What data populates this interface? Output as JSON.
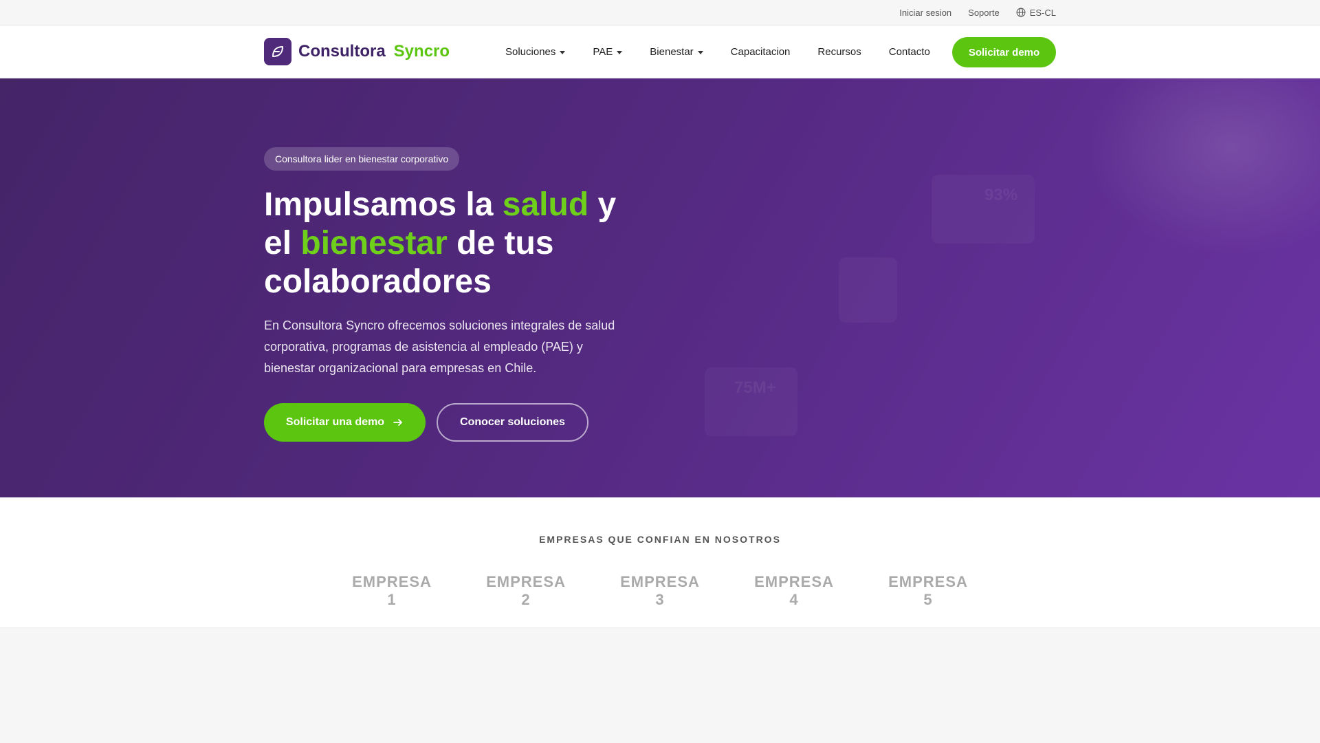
{
  "topbar": {
    "login": "Iniciar sesion",
    "support": "Soporte",
    "language": "ES-CL",
    "language_icon": "globe-icon"
  },
  "nav": {
    "logo_icon": "leaf-logo-icon",
    "logo_word1": "Consultora",
    "logo_word2": "Syncro",
    "items": [
      {
        "label": "Soluciones",
        "dropdown": true
      },
      {
        "label": "PAE",
        "dropdown": true
      },
      {
        "label": "Bienestar",
        "dropdown": true
      },
      {
        "label": "Capacitacion",
        "dropdown": false
      },
      {
        "label": "Recursos",
        "dropdown": false
      },
      {
        "label": "Contacto",
        "dropdown": false
      }
    ],
    "cta": "Solicitar demo"
  },
  "hero": {
    "badge": "Consultora lider en bienestar corporativo",
    "title_part1": "Impulsamos la ",
    "title_accent1": "salud",
    "title_part2": " y el ",
    "title_accent2": "bienestar",
    "title_part3": " de tus colaboradores",
    "description": "En Consultora Syncro ofrecemos soluciones integrales de salud corporativa, programas de asistencia al empleado (PAE) y bienestar organizacional para empresas en Chile.",
    "primary_button": "Solicitar una demo",
    "primary_button_icon": "arrow-right-icon",
    "secondary_button": "Conocer soluciones",
    "stat_a": "93%",
    "stat_b": "75M+"
  },
  "clients": {
    "title": "EMPRESAS QUE CONFIAN EN NOSOTROS",
    "logos": [
      "EMPRESA 1",
      "EMPRESA 2",
      "EMPRESA 3",
      "EMPRESA 4",
      "EMPRESA 5"
    ]
  },
  "colors": {
    "brand_purple": "#4f2a7a",
    "accent_green": "#5cc50f",
    "hero_gradient_start": "#452468",
    "hero_gradient_end": "#6a33a3"
  }
}
